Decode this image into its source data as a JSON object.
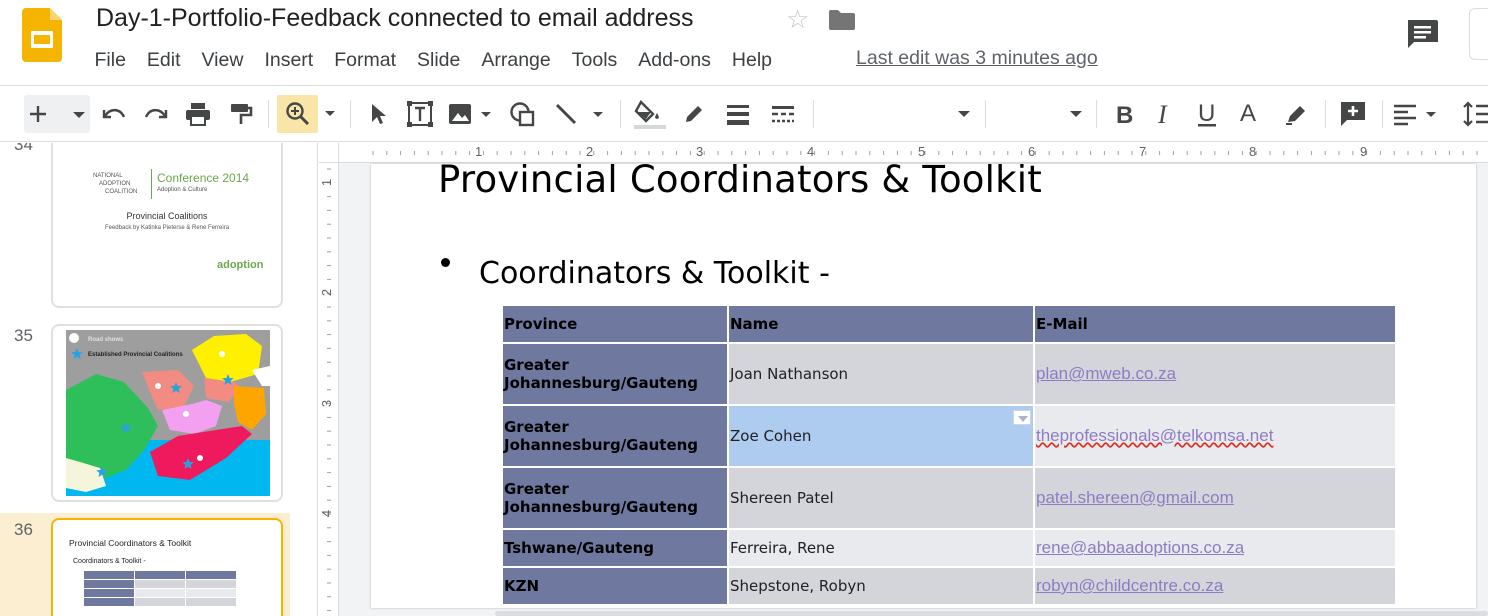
{
  "header": {
    "doc_title": "Day-1-Portfolio-Feedback connected to email address",
    "last_edit": "Last edit was 3 minutes ago",
    "menu": [
      "File",
      "Edit",
      "View",
      "Insert",
      "Format",
      "Slide",
      "Arrange",
      "Tools",
      "Add-ons",
      "Help"
    ]
  },
  "filmstrip": {
    "slides": [
      {
        "number": "34",
        "conference": "Conference 2014",
        "org_line1": "NATIONAL",
        "org_line2": "ADOPTION",
        "org_line3": "COALITION",
        "tagline": "Adoption & Culture",
        "title": "Provincial Coalitions",
        "subtitle": "Feedback by Katinka Pieterse & Rene Ferreira",
        "logo_text": "adoption"
      },
      {
        "number": "35",
        "legend_1": "Road shows",
        "legend_2": "Established Provincial Coalitions"
      },
      {
        "number": "36",
        "title": "Provincial Coordinators & Toolkit",
        "bullet": "Coordinators & Toolkit -"
      }
    ]
  },
  "ruler": {
    "top_labels": [
      "1",
      "2",
      "3",
      "4",
      "5",
      "6",
      "7",
      "8",
      "9"
    ],
    "left_labels": [
      "1",
      "2",
      "3",
      "4"
    ]
  },
  "slide": {
    "title": "Provincial Coordinators & Toolkit",
    "bullet": "Coordinators & Toolkit -",
    "table": {
      "headers": [
        "Province",
        "Name",
        "E-Mail"
      ],
      "rows": [
        {
          "province": "Greater Johannesburg/Gauteng",
          "name": "Joan Nathanson",
          "email": "plan@mweb.co.za"
        },
        {
          "province": "Greater Johannesburg/Gauteng",
          "name": "Zoe Cohen",
          "email": "theprofessionals@telkomsa.net"
        },
        {
          "province": "Greater Johannesburg/Gauteng",
          "name": "Shereen Patel",
          "email": "patel.shereen@gmail.com"
        },
        {
          "province": "Tshwane/Gauteng",
          "name": "Ferreira, Rene",
          "email": "rene@abbaadoptions.co.za"
        },
        {
          "province": "KZN",
          "name": "Shepstone, Robyn",
          "email": "robyn@childcentre.co.za"
        }
      ]
    }
  },
  "colors": {
    "table_header": "#6f799f",
    "row_dark": "#d3d5db",
    "row_light": "#e9eaee",
    "selected_cell": "#aecbf0",
    "link": "#8e7cc3",
    "selected_slide_border": "#f4b400",
    "zoom_button_bg": "#f9e5a8"
  },
  "icons": [
    "slides-logo-icon",
    "star-icon",
    "folder-icon",
    "comment-icon",
    "new-slide-icon",
    "undo-icon",
    "redo-icon",
    "print-icon",
    "paint-format-icon",
    "zoom-icon",
    "select-icon",
    "text-box-icon",
    "image-icon",
    "shape-icon",
    "line-icon",
    "fill-color-icon",
    "border-color-icon",
    "border-weight-icon",
    "border-dash-icon",
    "bold-icon",
    "italic-icon",
    "underline-icon",
    "text-color-icon",
    "highlight-icon",
    "insert-comment-icon",
    "align-icon",
    "line-spacing-icon"
  ]
}
